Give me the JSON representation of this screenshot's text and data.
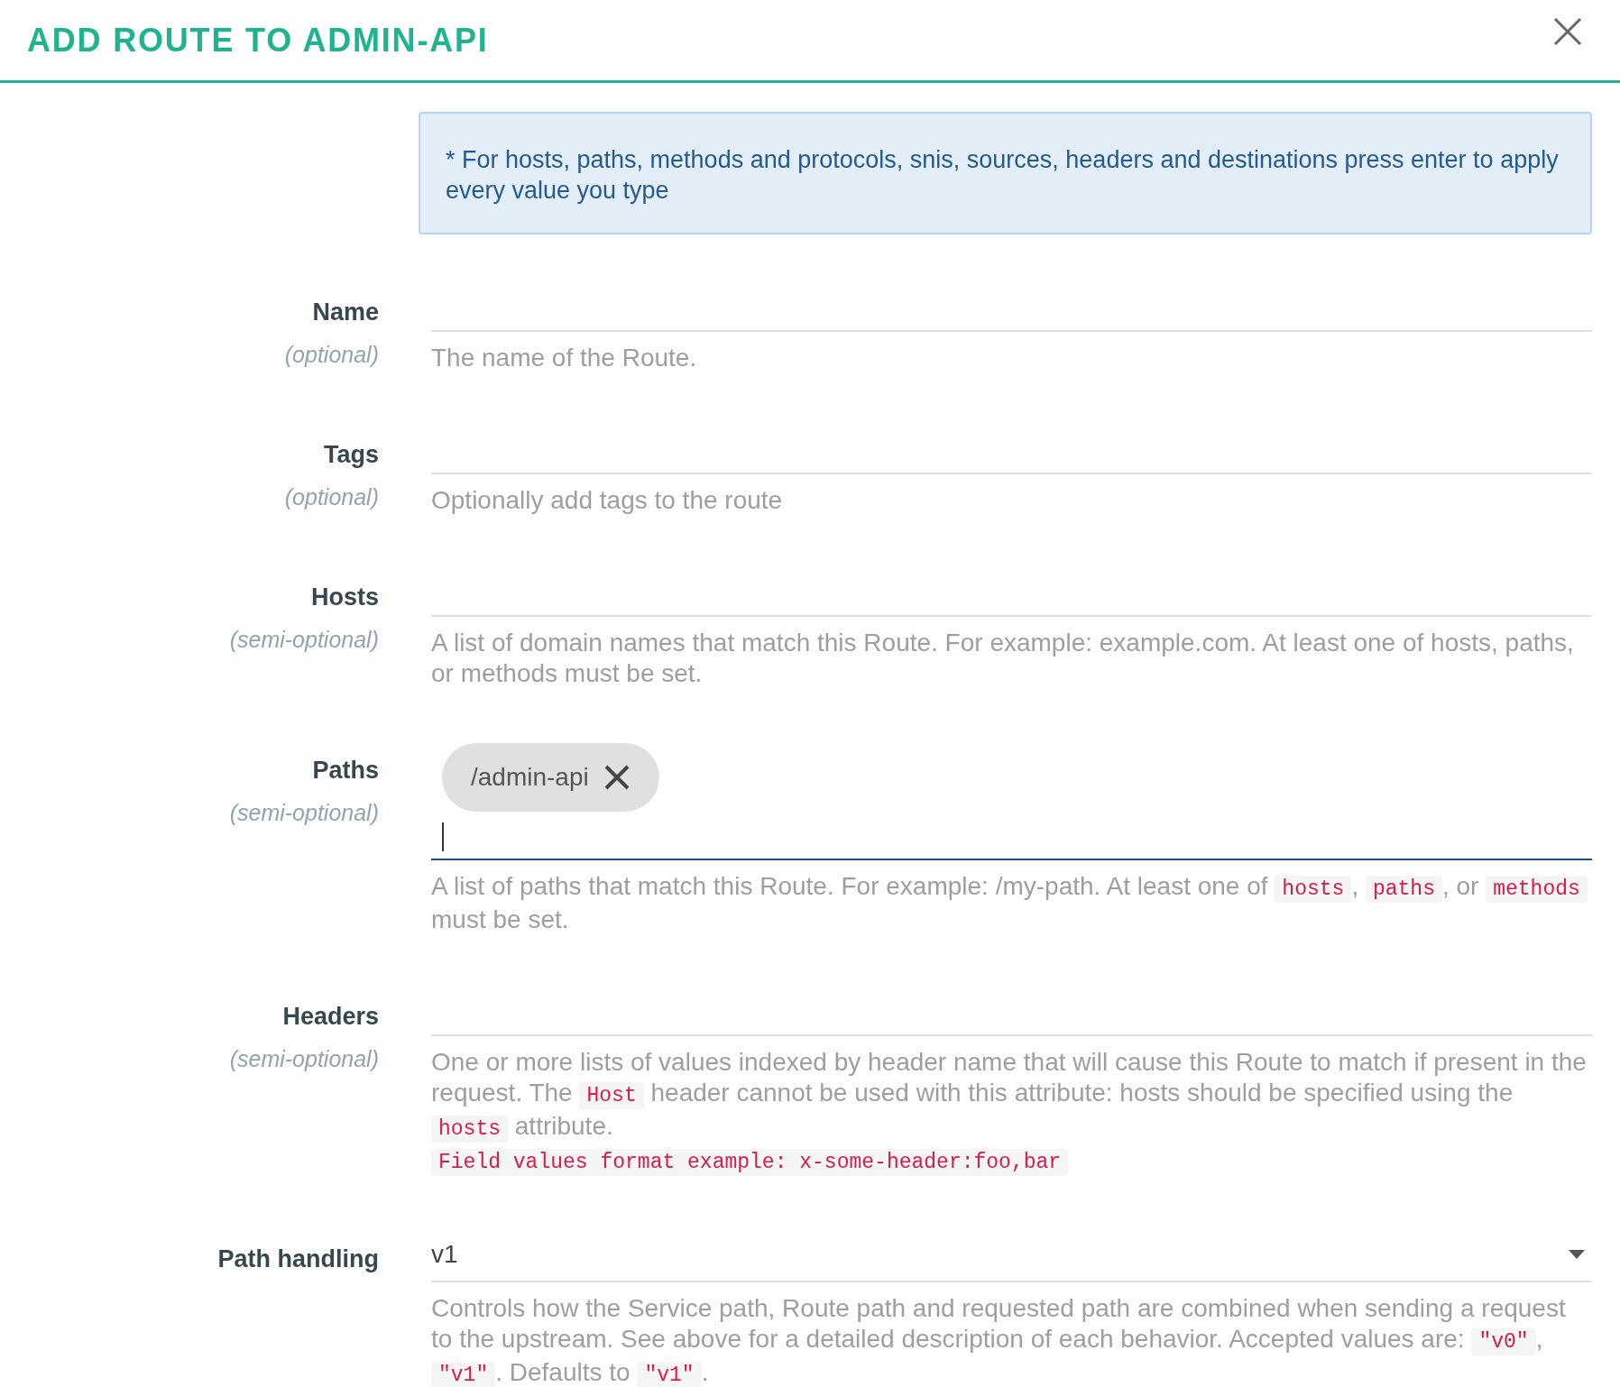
{
  "dialog": {
    "title": "ADD ROUTE TO ADMIN-API"
  },
  "info": "* For hosts, paths, methods and protocols, snis, sources, headers and destinations press enter to apply every value you type",
  "fields": [
    {
      "label": "Name",
      "note": "(optional)",
      "kind": "text",
      "focused": false,
      "help": [
        [
          {
            "kind": "text",
            "text": "The name of the Route."
          }
        ]
      ]
    },
    {
      "label": "Tags",
      "note": "(optional)",
      "kind": "text",
      "focused": false,
      "help": [
        [
          {
            "kind": "text",
            "text": "Optionally add tags to the route"
          }
        ]
      ]
    },
    {
      "label": "Hosts",
      "note": "(semi-optional)",
      "kind": "text",
      "focused": false,
      "help": [
        [
          {
            "kind": "text",
            "text": "A list of domain names that match this Route. For example: example.com. At least one of hosts, paths, or methods must be set."
          }
        ]
      ]
    },
    {
      "label": "Paths",
      "note": "(semi-optional)",
      "kind": "tags",
      "focused": true,
      "chips": [
        "/admin-api"
      ],
      "help": [
        [
          {
            "kind": "text",
            "text": "A list of paths that match this Route. For example: /my-path. At least one of "
          },
          {
            "kind": "code",
            "text": "hosts"
          },
          {
            "kind": "text",
            "text": ", "
          },
          {
            "kind": "code",
            "text": "paths"
          },
          {
            "kind": "text",
            "text": ", or "
          },
          {
            "kind": "code",
            "text": "methods"
          },
          {
            "kind": "text",
            "text": " must be set."
          }
        ]
      ]
    },
    {
      "label": "Headers",
      "note": "(semi-optional)",
      "kind": "text",
      "focused": false,
      "help": [
        [
          {
            "kind": "text",
            "text": "One or more lists of values indexed by header name that will cause this Route to match if present in the request. The "
          },
          {
            "kind": "code",
            "text": "Host"
          },
          {
            "kind": "text",
            "text": " header cannot be used with this attribute: hosts should be specified using the "
          },
          {
            "kind": "code",
            "text": "hosts"
          },
          {
            "kind": "text",
            "text": " attribute."
          }
        ],
        [
          {
            "kind": "code",
            "text": "Field values format example: x-some-header:foo,bar"
          }
        ]
      ]
    },
    {
      "label": "Path handling",
      "kind": "select",
      "focused": false,
      "value": "v1",
      "help": [
        [
          {
            "kind": "text",
            "text": "Controls how the Service path, Route path and requested path are combined when sending a request to the upstream. See above for a detailed description of each behavior. Accepted values are: "
          },
          {
            "kind": "code",
            "text": "\"v0\""
          },
          {
            "kind": "text",
            "text": ", "
          },
          {
            "kind": "code",
            "text": "\"v1\""
          },
          {
            "kind": "text",
            "text": ". Defaults to "
          },
          {
            "kind": "code",
            "text": "\"v1\""
          },
          {
            "kind": "text",
            "text": "."
          }
        ]
      ]
    }
  ]
}
